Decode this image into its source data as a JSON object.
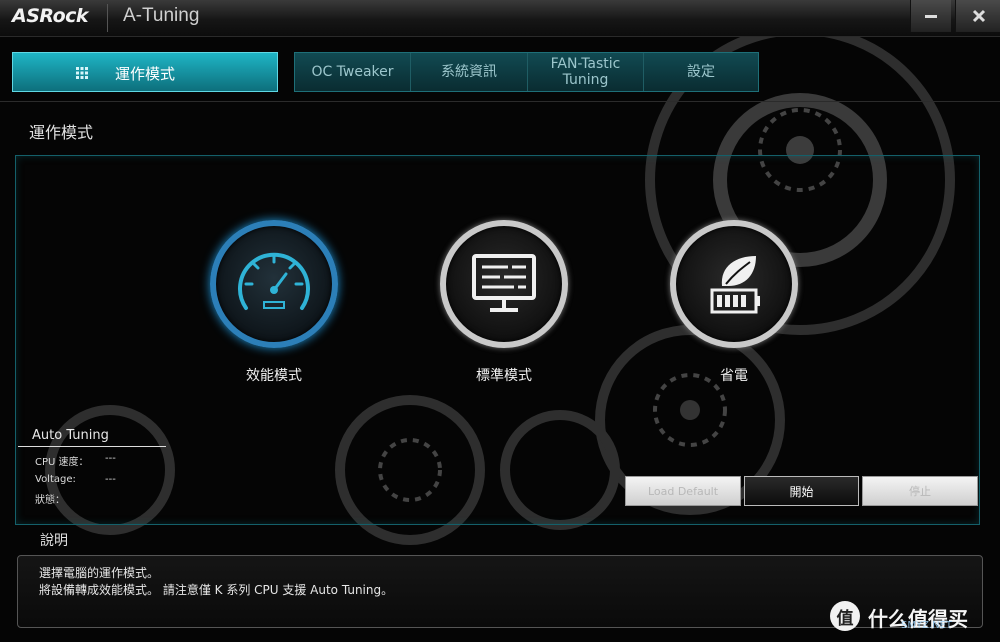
{
  "titlebar": {
    "logo": "ASRock",
    "app_title": "A-Tuning",
    "minimize_icon": "minimize-icon",
    "close_icon": "close-icon"
  },
  "nav": {
    "active_label": "運作模式",
    "active_icon": "grid-icon",
    "tabs": [
      {
        "label": "OC Tweaker"
      },
      {
        "label": "系統資訊"
      },
      {
        "label": "FAN-Tastic\nTuning"
      },
      {
        "label": "設定"
      }
    ]
  },
  "page": {
    "heading": "運作模式"
  },
  "modes": [
    {
      "label": "效能模式",
      "icon": "speedometer-icon",
      "active": true
    },
    {
      "label": "標準模式",
      "icon": "monitor-icon",
      "active": false
    },
    {
      "label": "省電",
      "icon": "eco-battery-icon",
      "active": false
    }
  ],
  "auto_tuning": {
    "title": "Auto Tuning",
    "rows": [
      {
        "key": "CPU 速度：",
        "value": "---"
      },
      {
        "key": "Voltage:",
        "value": "---"
      },
      {
        "key": "狀態：",
        "value": ""
      }
    ]
  },
  "buttons": {
    "load_default": "Load Default",
    "start": "開始",
    "stop": "停止"
  },
  "description": {
    "heading": "說明",
    "line1": "選擇電腦的運作模式。",
    "line2": "將設備轉成效能模式。 請注意僅 K 系列 CPU 支援 Auto Tuning。"
  },
  "watermark": {
    "symbol": "值",
    "text": "什么值得买",
    "site": "SMYZ.NET"
  },
  "colors": {
    "accent": "#1fb5c5",
    "active_ring": "#2c7fb8",
    "panel_border": "#14606a"
  }
}
